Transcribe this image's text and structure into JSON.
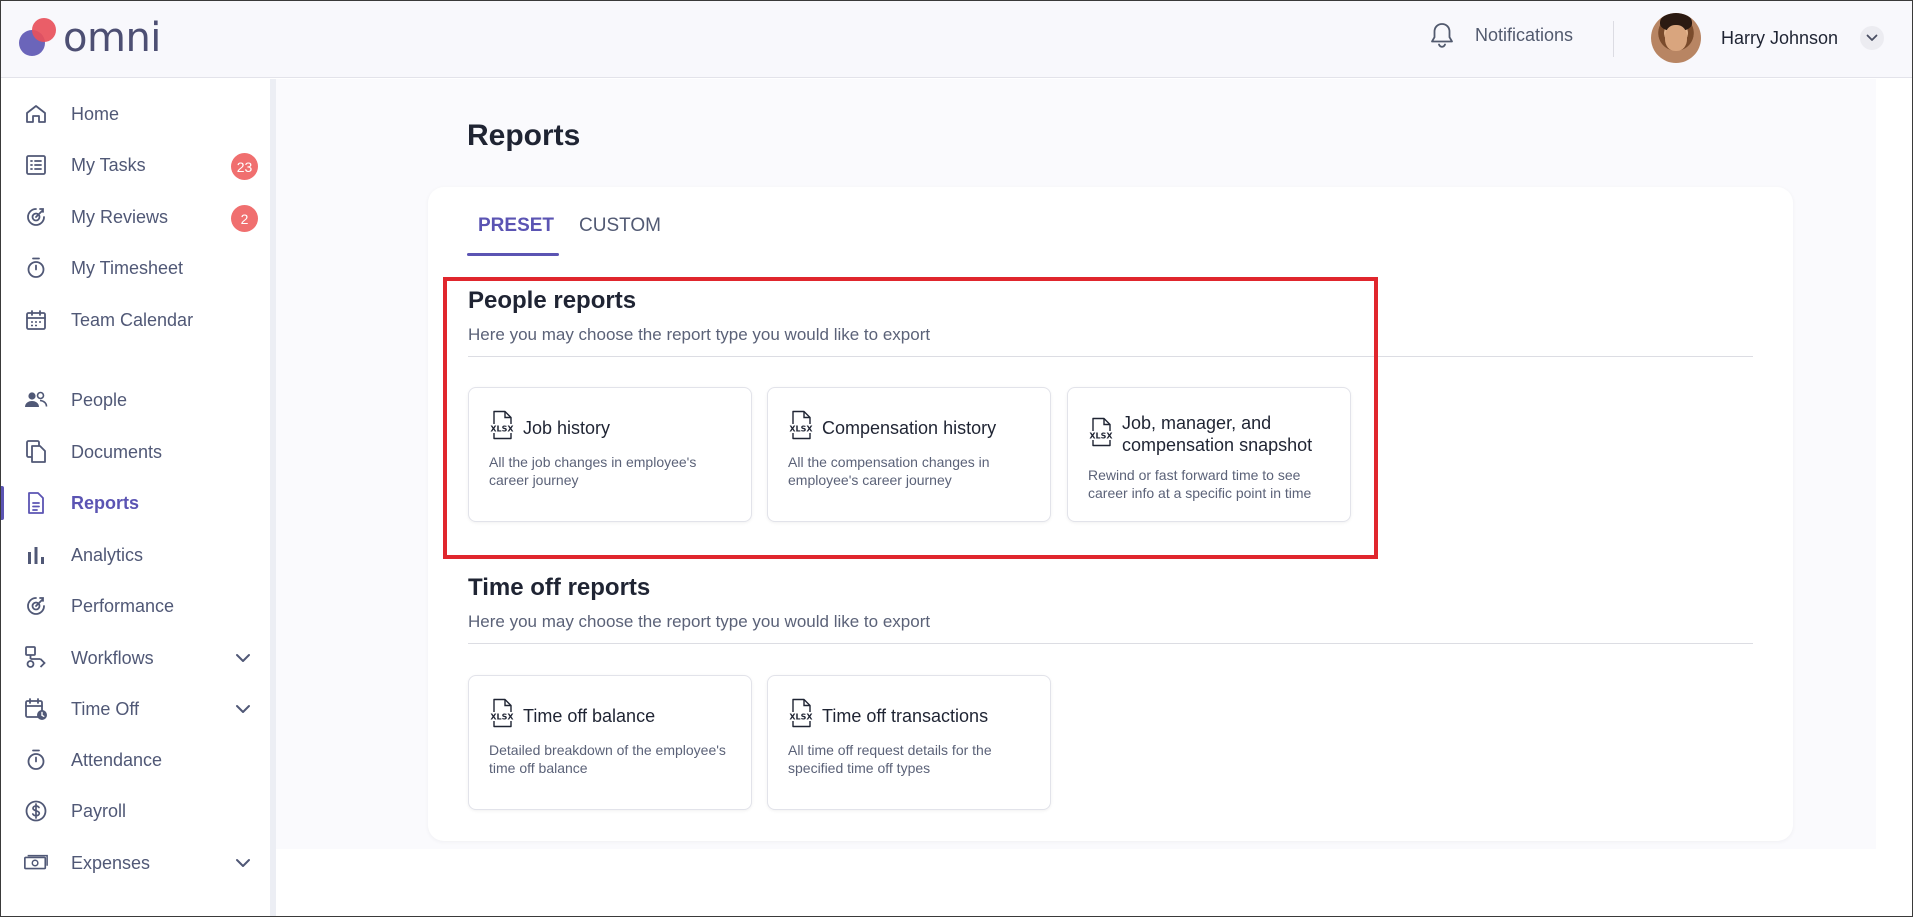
{
  "app": {
    "logo_text": "omni"
  },
  "header": {
    "notifications_label": "Notifications",
    "user_name": "Harry Johnson"
  },
  "sidebar": {
    "items": [
      {
        "label": "Home",
        "icon": "home-icon"
      },
      {
        "label": "My Tasks",
        "icon": "task-list-icon",
        "badge": "23"
      },
      {
        "label": "My Reviews",
        "icon": "reviews-icon",
        "badge": "2"
      },
      {
        "label": "My Timesheet",
        "icon": "stopwatch-icon"
      },
      {
        "label": "Team Calendar",
        "icon": "calendar-icon"
      },
      {
        "label": "People",
        "icon": "people-icon"
      },
      {
        "label": "Documents",
        "icon": "documents-icon"
      },
      {
        "label": "Reports",
        "icon": "report-icon",
        "active": true
      },
      {
        "label": "Analytics",
        "icon": "bar-chart-icon"
      },
      {
        "label": "Performance",
        "icon": "performance-icon"
      },
      {
        "label": "Workflows",
        "icon": "workflow-icon",
        "expandable": true
      },
      {
        "label": "Time Off",
        "icon": "calendar-clock-icon",
        "expandable": true
      },
      {
        "label": "Attendance",
        "icon": "stopwatch-icon"
      },
      {
        "label": "Payroll",
        "icon": "dollar-icon"
      },
      {
        "label": "Expenses",
        "icon": "cash-icon",
        "expandable": true
      }
    ]
  },
  "main": {
    "page_title": "Reports",
    "tabs": [
      {
        "label": "PRESET",
        "active": true
      },
      {
        "label": "CUSTOM",
        "active": false
      }
    ],
    "sections": [
      {
        "title": "People reports",
        "subtitle": "Here you may choose the report type you would like to export",
        "cards": [
          {
            "title": "Job history",
            "description": "All the job changes in employee's career journey",
            "icon": "xlsx-file-icon"
          },
          {
            "title": "Compensation history",
            "description": "All the compensation changes in employee's career journey",
            "icon": "xlsx-file-icon"
          },
          {
            "title": "Job, manager, and compensation snapshot",
            "description": "Rewind or fast forward time to see career info at a specific point in time",
            "icon": "xlsx-file-icon"
          }
        ]
      },
      {
        "title": "Time off reports",
        "subtitle": "Here you may choose the report type you would like to export",
        "cards": [
          {
            "title": "Time off balance",
            "description": "Detailed breakdown of the employee's time off balance",
            "icon": "xlsx-file-icon"
          },
          {
            "title": "Time off transactions",
            "description": "All time off request details for the specified time off types",
            "icon": "xlsx-file-icon"
          }
        ]
      }
    ]
  },
  "colors": {
    "accent": "#5b54b3",
    "badge": "#f06f6f",
    "highlight": "#e0262d",
    "logo_red": "#e8505b",
    "logo_purple": "#5b54b3"
  }
}
